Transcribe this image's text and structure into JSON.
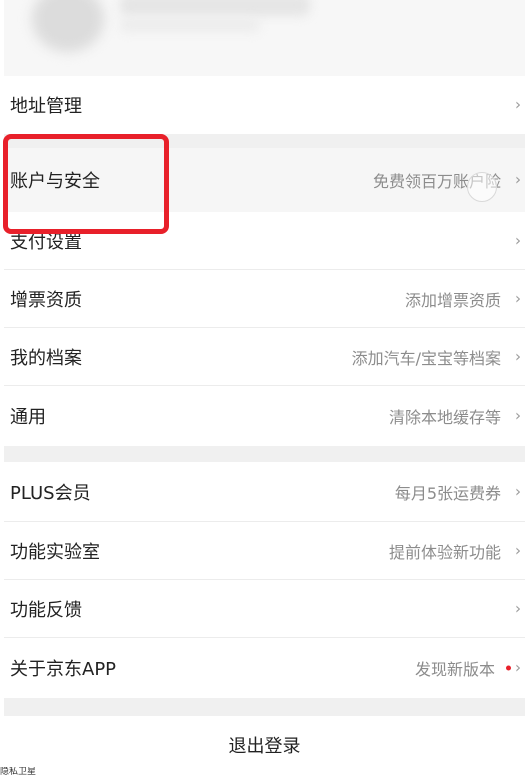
{
  "rows": {
    "address": {
      "label": "地址管理",
      "value": ""
    },
    "account": {
      "label": "账户与安全",
      "value": "免费领百万账户险"
    },
    "payment": {
      "label": "支付设置",
      "value": ""
    },
    "invoice": {
      "label": "增票资质",
      "value": "添加增票资质"
    },
    "archive": {
      "label": "我的档案",
      "value": "添加汽车/宝宝等档案"
    },
    "general": {
      "label": "通用",
      "value": "清除本地缓存等"
    },
    "plus": {
      "label": "PLUS会员",
      "value": "每月5张运费券"
    },
    "lab": {
      "label": "功能实验室",
      "value": "提前体验新功能"
    },
    "feedback": {
      "label": "功能反馈",
      "value": ""
    },
    "about": {
      "label": "关于京东APP",
      "value": "发现新版本"
    }
  },
  "chevron": "›",
  "logout": {
    "label": "退出登录"
  },
  "footer": {
    "text": "隐私卫星"
  },
  "colors": {
    "highlight": "#e8202a",
    "gap": "#f0f0f0",
    "secondary_text": "#8c8c8c"
  },
  "icons": {
    "chevron": "chevron-right-icon",
    "update_dot": "red-dot-icon"
  }
}
